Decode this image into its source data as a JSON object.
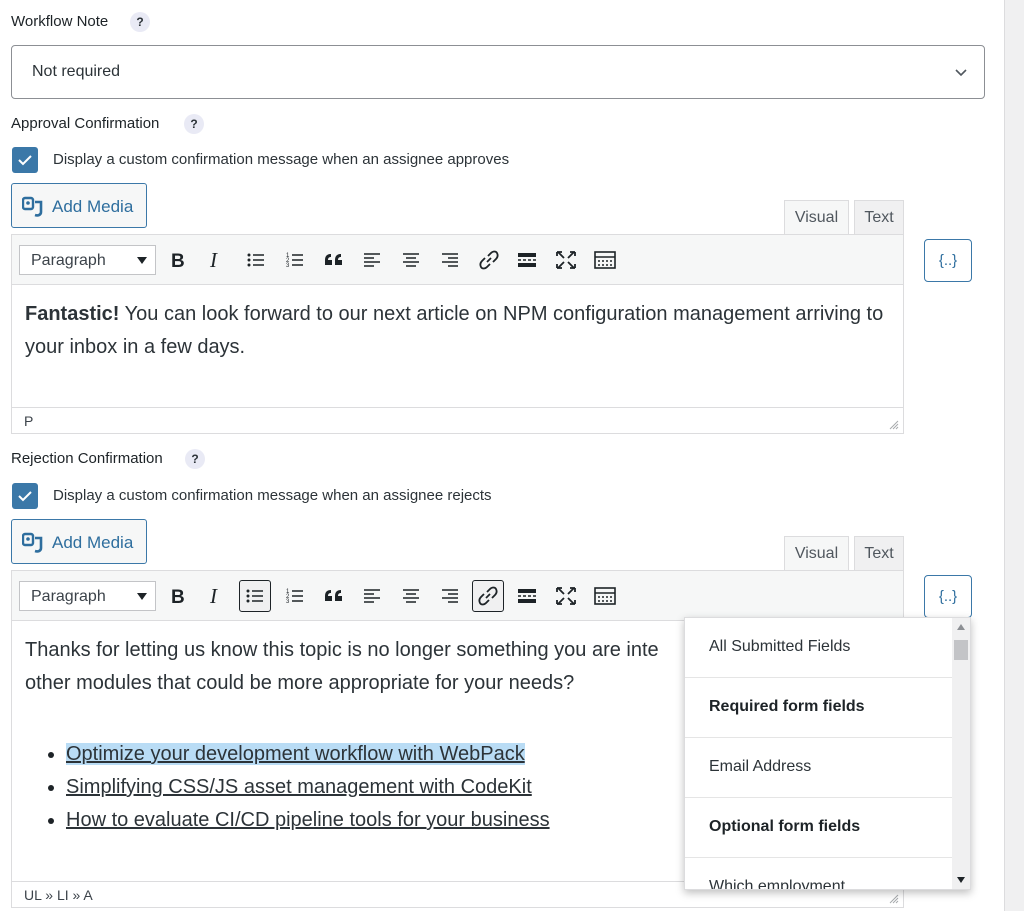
{
  "workflow_note": {
    "label": "Workflow Note",
    "help": "?",
    "selected": "Not required"
  },
  "approval": {
    "label": "Approval Confirmation",
    "help": "?",
    "checkbox_label": "Display a custom confirmation message when an assignee approves",
    "checked": true,
    "add_media": "Add Media",
    "tabs": [
      "Visual",
      "Text"
    ],
    "active_tab": "Visual",
    "format": "Paragraph",
    "content_bold": "Fantastic!",
    "content_text": " You can look forward to our next article on NPM configuration management arriving to your inbox in a few days.",
    "path": "P",
    "merge_tag": "{..}"
  },
  "rejection": {
    "label": "Rejection Confirmation",
    "help": "?",
    "checkbox_label": "Display a custom confirmation message when an assignee rejects",
    "checked": true,
    "add_media": "Add Media",
    "tabs": [
      "Visual",
      "Text"
    ],
    "active_tab": "Visual",
    "format": "Paragraph",
    "content_line1": "Thanks for letting us know this topic is no longer something you are inte",
    "content_line2": "other modules that could be more appropriate for your needs?",
    "links": [
      "Optimize your development workflow with WebPack",
      "Simplifying CSS/JS asset management with CodeKit",
      "How to evaluate CI/CD pipeline tools for your business"
    ],
    "path": "UL » LI » A",
    "merge_tag": "{..}"
  },
  "toolbar_icons": [
    "bold-icon",
    "italic-icon",
    "bullet-list-icon",
    "numbered-list-icon",
    "blockquote-icon",
    "align-left-icon",
    "align-center-icon",
    "align-right-icon",
    "link-icon",
    "read-more-icon",
    "fullscreen-icon",
    "toolbar-toggle-icon"
  ],
  "merge_tags_dropdown": {
    "items": [
      {
        "label": "All Submitted Fields",
        "group": false
      },
      {
        "label": "Required form fields",
        "group": true
      },
      {
        "label": "Email Address",
        "group": false
      },
      {
        "label": "Optional form fields",
        "group": true
      },
      {
        "label": "Which employment",
        "group": false
      }
    ]
  },
  "colors": {
    "accent": "#3b78a8",
    "link_highlight": "#b9dcf5",
    "spellcheck": "#d63638"
  }
}
